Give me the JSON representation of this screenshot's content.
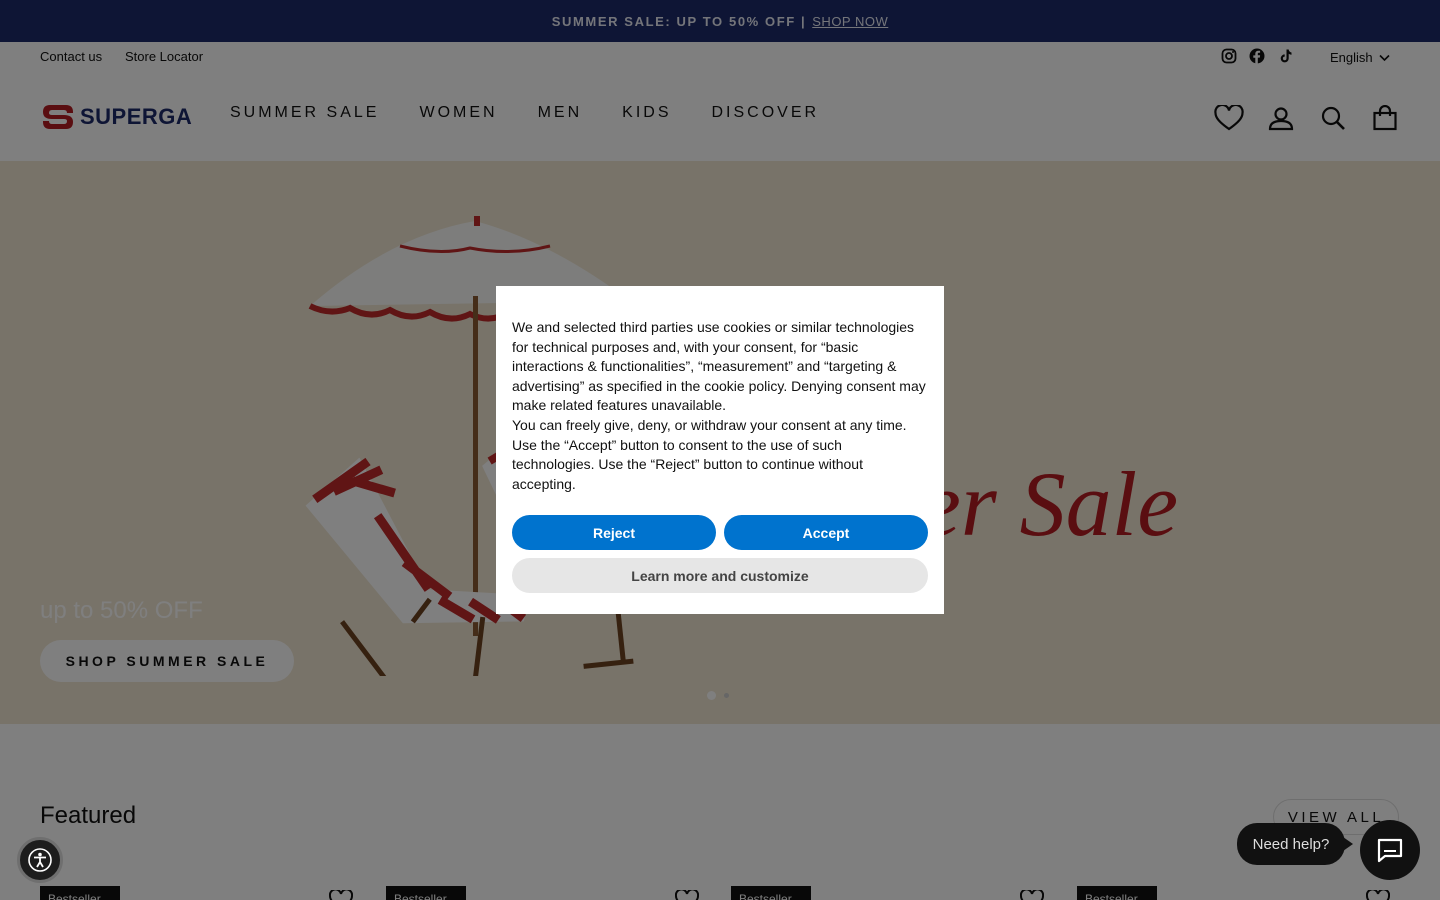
{
  "announcement": {
    "text": "SUMMER SALE: UP TO 50% OFF |",
    "link": "SHOP NOW"
  },
  "utility": {
    "links": [
      "Contact us",
      "Store Locator"
    ],
    "social": [
      "instagram-icon",
      "facebook-icon",
      "tiktok-icon"
    ],
    "language": "English"
  },
  "header": {
    "logo": "SUPERGA",
    "nav": [
      "SUMMER SALE",
      "WOMEN",
      "MEN",
      "KIDS",
      "DISCOVER"
    ],
    "icons": [
      "heart-icon",
      "account-icon",
      "search-icon",
      "cart-icon"
    ]
  },
  "hero": {
    "headline_fragment": "er Sale",
    "offer": "up to 50% OFF",
    "cta": "SHOP SUMMER SALE",
    "slides": 2,
    "active_slide": 1
  },
  "featured": {
    "title": "Featured",
    "view_all": "VIEW ALL",
    "badges": [
      "Bestseller",
      "Bestseller",
      "Bestseller",
      "Bestseller"
    ]
  },
  "cookie": {
    "text1": "We and selected third parties use cookies or similar technologies for technical purposes and, with your consent, for “basic interactions & functionalities”, “measurement” and “targeting & advertising” as specified in the cookie policy. Denying consent may make related features unavailable.",
    "text2": "You can freely give, deny, or withdraw your consent at any time. Use the “Accept” button to consent to the use of such technologies. Use the “Reject” button to continue without accepting.",
    "reject": "Reject",
    "accept": "Accept",
    "customize": "Learn more and customize"
  },
  "widgets": {
    "help": "Need help?"
  },
  "colors": {
    "announcement_bg": "#1d2a6b",
    "brand_red": "#b51d23",
    "accept_blue": "#0073ce"
  }
}
